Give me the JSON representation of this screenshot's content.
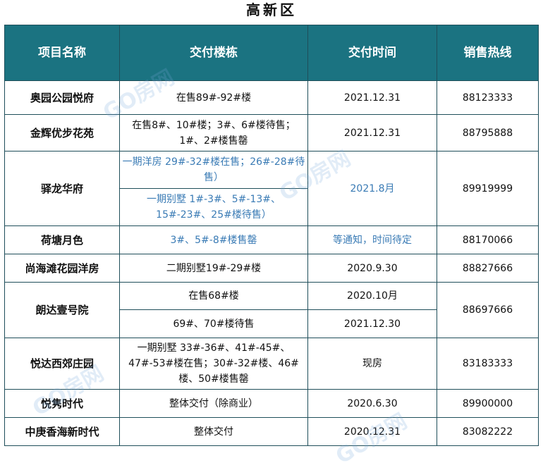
{
  "title": "高新区",
  "headers": [
    "项目名称",
    "交付楼栋",
    "交付时间",
    "销售热线"
  ],
  "rows": [
    {
      "name": "奥园公园悦府",
      "buildings": [
        "在售89#-92#楼"
      ],
      "times": [
        "2021.12.31"
      ],
      "hotline": "88123333"
    },
    {
      "name": "金辉优步花苑",
      "buildings": [
        "在售8#、10#楼；3#、6#楼待售；1#、2#楼售罄"
      ],
      "times": [
        "2021.12.31"
      ],
      "hotline": "88795888"
    },
    {
      "name": "驿龙华府",
      "buildings": [
        "一期洋房 29#-32#楼在售；26#-28#待售）",
        "一期别墅 1#-3#、5#-13#、15#-23#、25#楼待售）"
      ],
      "times": [
        "2021.8月"
      ],
      "hotline": "89919999"
    },
    {
      "name": "荷塘月色",
      "buildings": [
        "3#、5#-8#楼售罄"
      ],
      "times": [
        "等通知，时间待定"
      ],
      "hotline": "88170066"
    },
    {
      "name": "尚海滩花园洋房",
      "buildings": [
        "二期别墅19#-29#楼"
      ],
      "times": [
        "2020.9.30"
      ],
      "hotline": "88827666"
    },
    {
      "name": "朗达壹号院",
      "buildings": [
        "在售68#楼",
        "69#、70#楼待售"
      ],
      "times": [
        "2020.10月",
        "2021.12.30"
      ],
      "hotline": "88697666"
    },
    {
      "name": "悦达西郊庄园",
      "buildings": [
        "一期别墅 33#-36#、41#-45#、47#-53#楼在售；30#-32#楼、46#楼、50#楼售罄"
      ],
      "times": [
        "现房"
      ],
      "hotline": "83183333"
    },
    {
      "name": "悦隽时代",
      "buildings": [
        "整体交付（除商业）"
      ],
      "times": [
        "2020.6.30"
      ],
      "hotline": "89900000"
    },
    {
      "name": "中庚香海新时代",
      "buildings": [
        "整体交付"
      ],
      "times": [
        "2020.12.31"
      ],
      "hotline": "83082222"
    }
  ],
  "watermark": "GO房网",
  "colors": {
    "header_bg": "#1b7381",
    "header_text": "#ffffff",
    "blue_text": "#3a7bb5",
    "border": "#1f4e5a"
  }
}
